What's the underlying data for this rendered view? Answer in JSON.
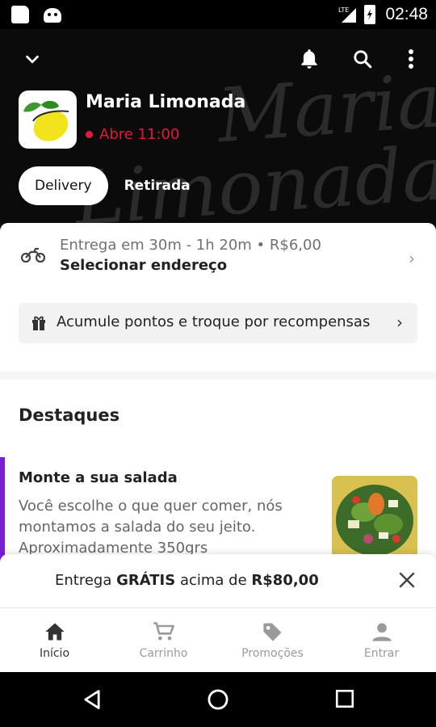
{
  "status_bar": {
    "time": "02:48",
    "network": "LTE"
  },
  "header": {
    "watermark_line1": "Maria",
    "watermark_line2": "Limonada",
    "store_name": "Maria Limonada",
    "store_status": "Abre 11:00",
    "status_color": "#e5183b",
    "modes": {
      "delivery": "Delivery",
      "pickup": "Retirada"
    },
    "icons": [
      "chevron-down-icon",
      "bell-icon",
      "search-icon",
      "more-vert-icon"
    ]
  },
  "delivery": {
    "line1": "Entrega em 30m - 1h 20m • R$6,00",
    "line2": "Selecionar endereço"
  },
  "loyalty": {
    "text": "Acumule pontos e troque por recompensas"
  },
  "highlights": {
    "title": "Destaques",
    "item": {
      "name": "Monte a sua salada",
      "description": "Você escolhe o que quer comer, nós montamos a salada do seu jeito.",
      "description_cut": "Aproximadamente 350grs"
    }
  },
  "free_delivery": {
    "prefix": "Entrega",
    "bold1": "GRÁTIS",
    "middle": "acima de",
    "bold2": "R$80,00"
  },
  "bottom_nav": [
    {
      "label": "Início",
      "icon": "home-icon",
      "active": true
    },
    {
      "label": "Carrinho",
      "icon": "cart-icon",
      "active": false
    },
    {
      "label": "Promoções",
      "icon": "tag-icon",
      "active": false
    },
    {
      "label": "Entrar",
      "icon": "person-icon",
      "active": false
    }
  ],
  "colors": {
    "accent": "#7a1ed6",
    "header_bg": "#0b0b0b",
    "status_red": "#e5183b"
  }
}
